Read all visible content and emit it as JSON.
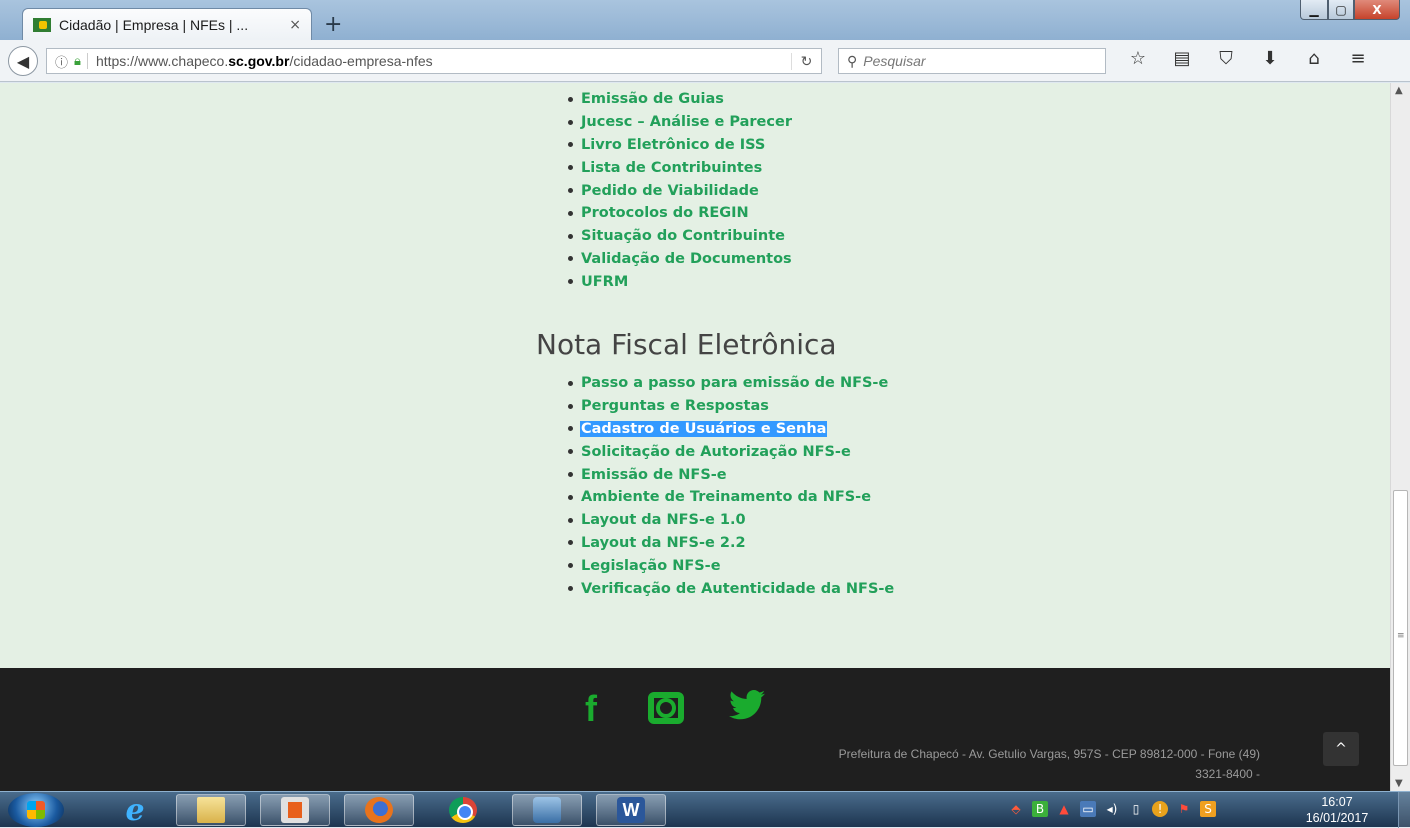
{
  "browser": {
    "tab_title": "Cidadão | Empresa | NFEs | ...",
    "tab_close": "×",
    "new_tab": "+",
    "url_prefix": "https://www.chapeco.",
    "url_domain": "sc.gov.br",
    "url_path": "/cidadao-empresa-nfes",
    "search_placeholder": "Pesquisar",
    "window_controls": {
      "minimize": "▁",
      "maximize": "▢",
      "close": "X"
    }
  },
  "content": {
    "list1": [
      "Emissão de Guias",
      "Jucesc – Análise e Parecer",
      "Livro Eletrônico de ISS",
      "Lista de Contribuintes",
      "Pedido de Viabilidade",
      "Protocolos do REGIN",
      "Situação do Contribuinte",
      "Validação de Documentos",
      "UFRM"
    ],
    "section_title": "Nota Fiscal Eletrônica",
    "list2": [
      "Passo a passo para emissão de NFS-e",
      "Perguntas e Respostas",
      "Cadastro de Usuários e Senha",
      "Solicitação de Autorização NFS-e",
      "Emissão de NFS-e",
      "Ambiente de Treinamento da NFS-e",
      "Layout da NFS-e 1.0",
      "Layout da NFS-e 2.2",
      "Legislação NFS-e",
      "Verificação de Autenticidade da NFS-e"
    ],
    "selected_item": "Cadastro de Usuários e Senha",
    "link_color": "#22a05a",
    "selection_color": "#3399ff"
  },
  "footer": {
    "social_icons": [
      "facebook-icon",
      "instagram-icon",
      "twitter-icon"
    ],
    "facebook_glyph": "f",
    "address_line1": "Prefeitura de Chapecó - Av. Getulio Vargas, 957S - CEP 89812-000 - Fone (49)",
    "address_line2": "3321-8400 -",
    "back_to_top": "^",
    "social_color": "#1aab2e"
  },
  "taskbar": {
    "time": "16:07",
    "date": "16/01/2017",
    "word_glyph": "W",
    "ie_glyph": "e"
  }
}
